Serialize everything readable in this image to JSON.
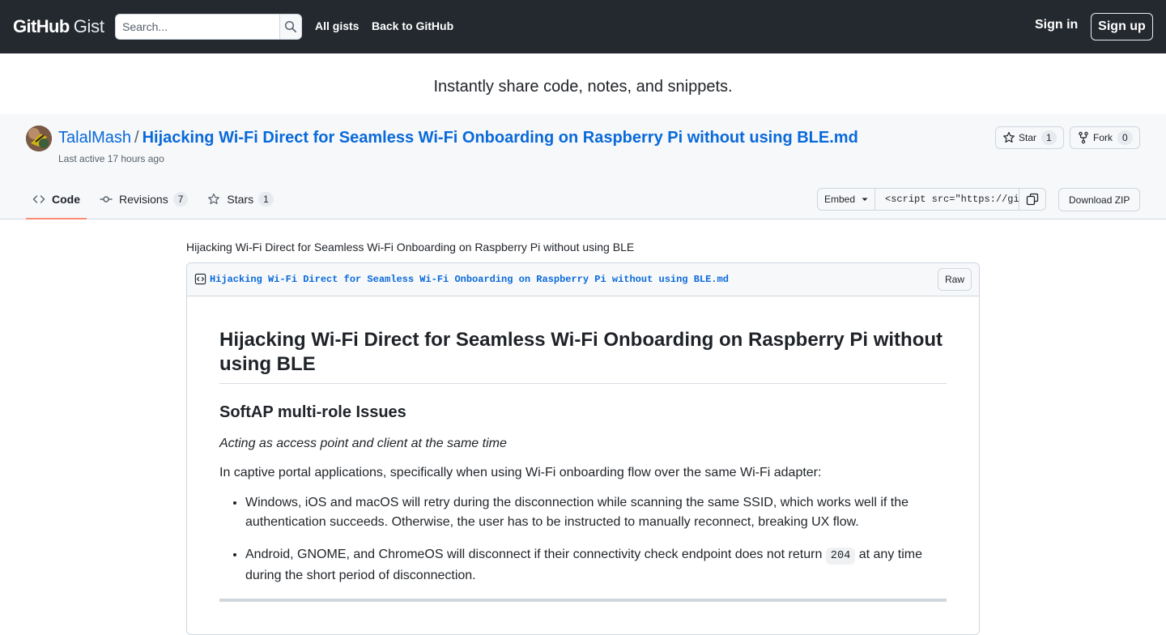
{
  "header": {
    "logo_github": "GitHub",
    "logo_gist": "Gist",
    "search_placeholder": "Search...",
    "nav_all_gists": "All gists",
    "nav_back": "Back to GitHub",
    "sign_in": "Sign in",
    "sign_up": "Sign up"
  },
  "tagline": "Instantly share code, notes, and snippets.",
  "gist": {
    "owner": "TalalMash",
    "separator": "/",
    "filename_title": "Hijacking Wi-Fi Direct for Seamless Wi-Fi Onboarding on Raspberry Pi without using BLE.md",
    "last_active": "Last active 17 hours ago",
    "star_label": "Star",
    "star_count": "1",
    "fork_label": "Fork",
    "fork_count": "0",
    "tabs": [
      {
        "label": "Code",
        "count": ""
      },
      {
        "label": "Revisions",
        "count": "7"
      },
      {
        "label": "Stars",
        "count": "1"
      }
    ],
    "embed_label": "Embed",
    "embed_value": "<script src=\"https://gist.github.com/",
    "download_zip": "Download ZIP"
  },
  "content": {
    "description": "Hijacking Wi-Fi Direct for Seamless Wi-Fi Onboarding on Raspberry Pi without using BLE",
    "file_name": "Hijacking Wi-Fi Direct for Seamless Wi-Fi Onboarding on Raspberry Pi without using BLE.md",
    "raw_label": "Raw",
    "h1": "Hijacking Wi-Fi Direct for Seamless Wi-Fi Onboarding on Raspberry Pi without using BLE",
    "h2": "SoftAP multi-role Issues",
    "em": "Acting as access point and client at the same time",
    "para": "In captive portal applications, specifically when using Wi-Fi onboarding flow over the same Wi-Fi adapter:",
    "bullet1": "Windows, iOS and macOS will retry during the disconnection while scanning the same SSID, which works well if the authentication succeeds. Otherwise, the user has to be instructed to manually reconnect, breaking UX flow.",
    "bullet2_a": "Android, GNOME, and ChromeOS will disconnect if their connectivity check endpoint does not return ",
    "bullet2_code": "204",
    "bullet2_b": " at any time during the short period of disconnection."
  }
}
